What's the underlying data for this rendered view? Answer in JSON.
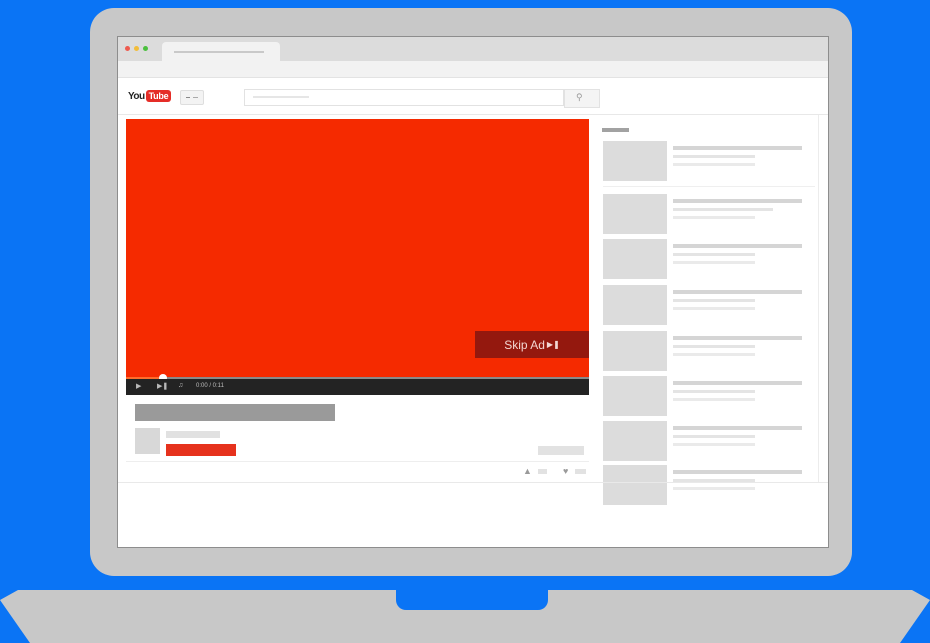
{
  "page": {
    "background_color": "#0a74f5"
  },
  "youtube": {
    "logo_you": "You",
    "logo_tube": "Tube",
    "brand_color": "#e52d27",
    "search_icon": "search-icon"
  },
  "player": {
    "background_color": "#f52a00",
    "skip_ad_label": "Skip Ad",
    "skip_icon": "skip-next-icon",
    "progress_fraction": 0.08,
    "time_text": "0:00 / 0:11",
    "controls": [
      "play-icon",
      "next-icon",
      "volume-icon"
    ]
  },
  "related_videos_count": 8
}
